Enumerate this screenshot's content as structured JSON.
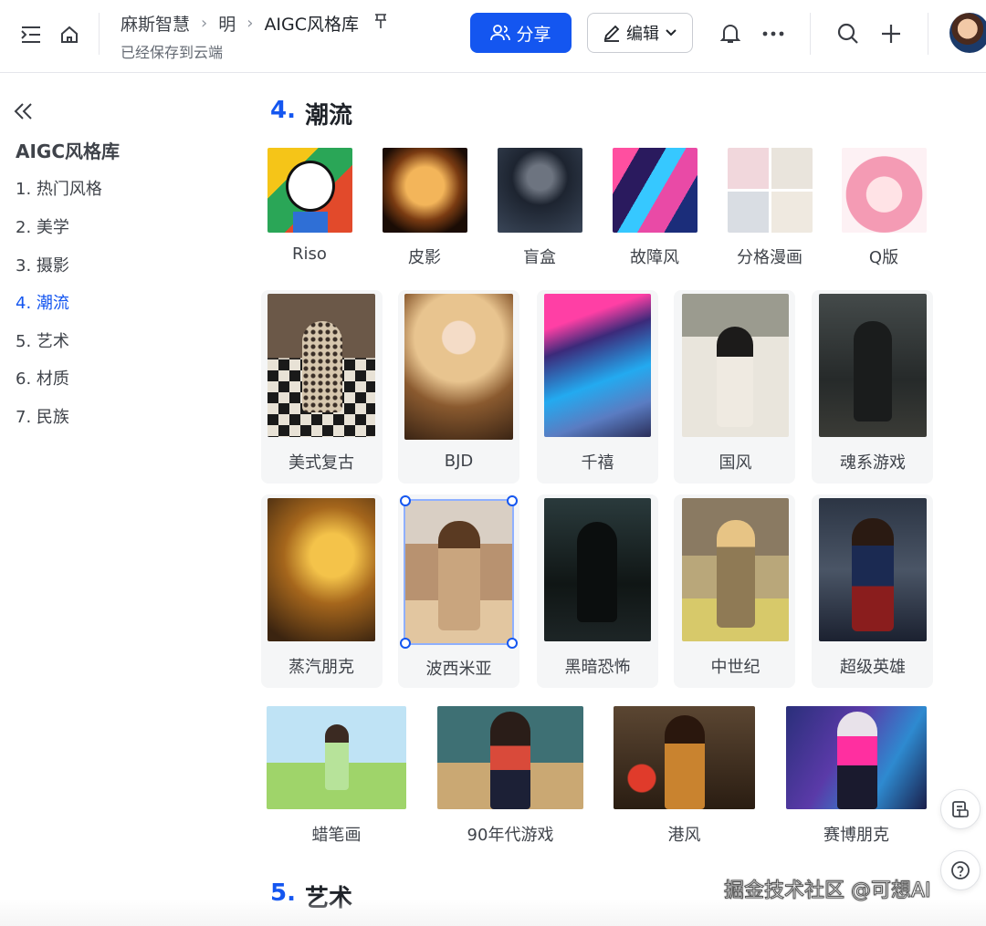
{
  "header": {
    "toggle_icon": "sidebar-toggle-icon",
    "home_icon": "home-icon",
    "breadcrumb": [
      "麻斯智慧",
      "明",
      "AIGC风格库"
    ],
    "pin_icon": "pin-icon",
    "saved_text": "已经保存到云端",
    "share_label": "分享",
    "edit_label": "编辑",
    "bell_icon": "bell-icon",
    "more_icon": "more-icon",
    "search_icon": "search-icon",
    "add_icon": "plus-icon",
    "accent": "#1456f0"
  },
  "toc": {
    "title": "AIGC风格库",
    "items": [
      "1. 热门风格",
      "2. 美学",
      "3. 摄影",
      "4. 潮流",
      "5. 艺术",
      "6. 材质",
      "7. 民族"
    ],
    "active_index": 3
  },
  "section4": {
    "num": "4.",
    "title": "潮流"
  },
  "row1": [
    "Riso",
    "皮影",
    "盲盒",
    "故障风",
    "分格漫画",
    "Q版"
  ],
  "grid": [
    "美式复古",
    "BJD",
    "千禧",
    "国风",
    "魂系游戏",
    "蒸汽朋克",
    "波西米亚",
    "黑暗恐怖",
    "中世纪",
    "超级英雄"
  ],
  "row4": [
    "蜡笔画",
    "90年代游戏",
    "港风",
    "赛博朋克"
  ],
  "section5": {
    "num": "5.",
    "title": "艺术"
  },
  "watermark": "掘金技术社区 @可想AI"
}
